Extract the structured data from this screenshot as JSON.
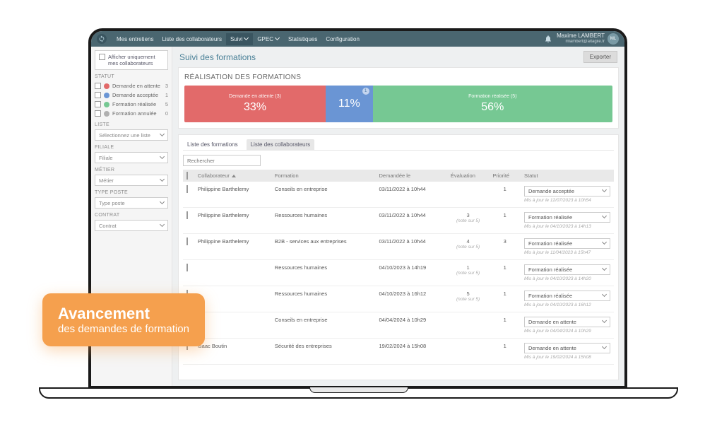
{
  "nav": {
    "items": [
      "Mes entretiens",
      "Liste des collaborateurs",
      "Suivi",
      "GPEC",
      "Statistiques",
      "Configuration"
    ],
    "active_index": 2
  },
  "user": {
    "name": "Maxime LAMBERT",
    "email": "mlambert@altagile.fr",
    "avatar_initials": "ML"
  },
  "header": {
    "title": "Suivi des formations",
    "export_label": "Exporter"
  },
  "sidebar": {
    "toggle_label": "Afficher uniquement mes collaborateurs",
    "statut_heading": "STATUT",
    "statuts": [
      {
        "label": "Demande en attente",
        "count": 3,
        "color": "#e26a6a"
      },
      {
        "label": "Demande acceptée",
        "count": 1,
        "color": "#6a95d4"
      },
      {
        "label": "Formation réalisée",
        "count": 5,
        "color": "#76c893"
      },
      {
        "label": "Formation annulée",
        "count": 0,
        "color": "#b0b0b0"
      }
    ],
    "liste_heading": "LISTE",
    "liste_placeholder": "Sélectionnez une liste",
    "filiale_heading": "FILIALE",
    "filiale_placeholder": "Filiale",
    "metier_heading": "MÉTIER",
    "metier_placeholder": "Métier",
    "typeposte_heading": "TYPE POSTE",
    "typeposte_placeholder": "Type poste",
    "contrat_heading": "CONTRAT",
    "contrat_placeholder": "Contrat"
  },
  "realisation": {
    "heading": "RÉALISATION DES FORMATIONS",
    "segments": [
      {
        "label": "Demande en attente (3)",
        "percent": "33%",
        "width": 33,
        "color": "#e26a6a"
      },
      {
        "label": "",
        "percent": "11%",
        "width": 11,
        "color": "#6a95d4",
        "badge": "1"
      },
      {
        "label": "Formation réalisée (5)",
        "percent": "56%",
        "width": 56,
        "color": "#76c893"
      }
    ]
  },
  "tabs": {
    "items": [
      "Liste des formations",
      "Liste des collaborateurs"
    ],
    "active_index": 1
  },
  "search": {
    "placeholder": "Rechercher"
  },
  "table": {
    "headers": [
      "",
      "Collaborateur",
      "Formation",
      "Demandée le",
      "Évaluation",
      "Priorité",
      "Statut"
    ],
    "note_suffix": "(note sur 5)",
    "rows": [
      {
        "collab": "Philippine Barthelemy",
        "formation": "Conseils en entreprise",
        "date": "03/11/2022 à 10h44",
        "eval": "",
        "prio": "1",
        "statut": "Demande acceptée",
        "updated": "Mis à jour le 12/07/2023 à 10h54"
      },
      {
        "collab": "Philippine Barthelemy",
        "formation": "Ressources humaines",
        "date": "03/11/2022 à 10h44",
        "eval": "3",
        "prio": "1",
        "statut": "Formation réalisée",
        "updated": "Mis à jour le 04/10/2023 à 14h13"
      },
      {
        "collab": "Philippine Barthelemy",
        "formation": "B2B - services aux entreprises",
        "date": "03/11/2022 à 10h44",
        "eval": "4",
        "prio": "3",
        "statut": "Formation réalisée",
        "updated": "Mis à jour le 11/04/2023 à 15h47"
      },
      {
        "collab": "",
        "formation": "Ressources humaines",
        "date": "04/10/2023 à 14h19",
        "eval": "1",
        "prio": "1",
        "statut": "Formation réalisée",
        "updated": "Mis à jour le 04/10/2023 à 14h20"
      },
      {
        "collab": "",
        "formation": "Ressources humaines",
        "date": "04/10/2023 à 16h12",
        "eval": "5",
        "prio": "1",
        "statut": "Formation réalisée",
        "updated": "Mis à jour le 04/10/2023 à 16h12"
      },
      {
        "collab": "",
        "formation": "Conseils en entreprise",
        "date": "04/04/2024 à 10h29",
        "eval": "",
        "prio": "1",
        "statut": "Demande en attente",
        "updated": "Mis à jour le 04/04/2024 à 10h29"
      },
      {
        "collab": "Isaac Boutin",
        "formation": "Sécurité des entreprises",
        "date": "19/02/2024 à 15h08",
        "eval": "",
        "prio": "1",
        "statut": "Demande en attente",
        "updated": "Mis à jour le 19/02/2024 à 15h08"
      }
    ]
  },
  "callout": {
    "title": "Avancement",
    "sub": "des demandes de formation"
  },
  "colors": {
    "accent": "#4a8097",
    "callout": "#f5a04e"
  }
}
